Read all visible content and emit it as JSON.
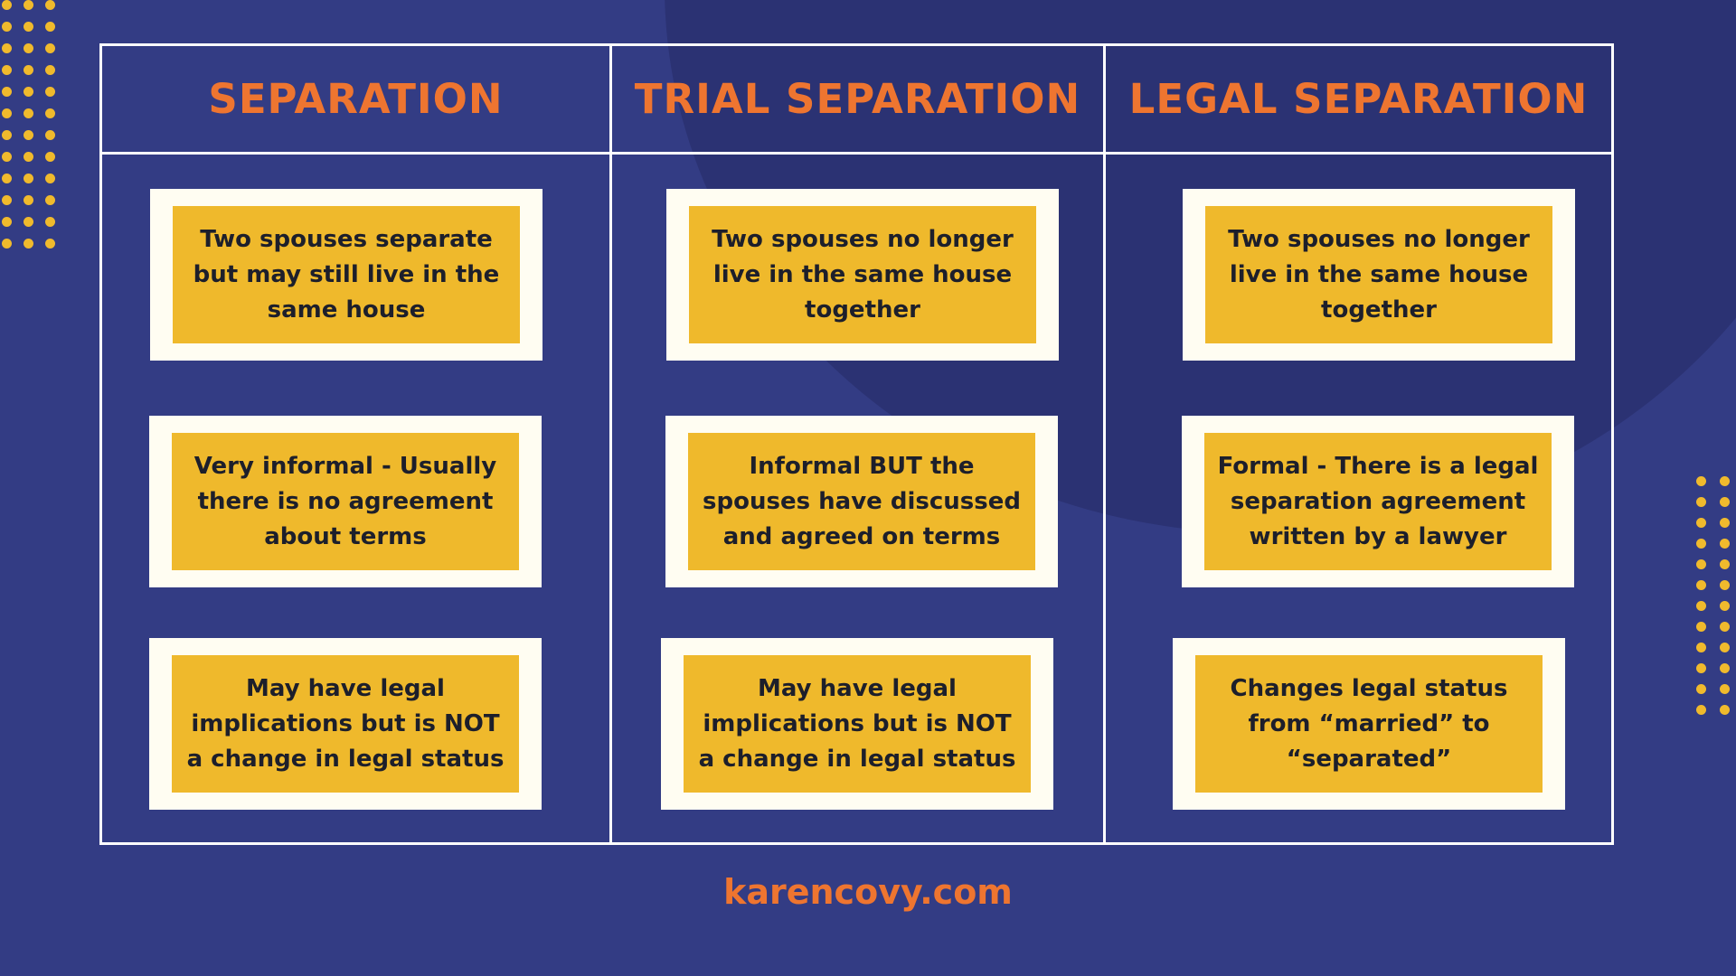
{
  "colors": {
    "background": "#333c84",
    "accent_orange": "#ee7530",
    "card_yellow": "#efb92c",
    "card_border": "#fffdf2",
    "dots": "#f0ba2d"
  },
  "columns": [
    {
      "title": "SEPARATION",
      "items": [
        "Two spouses separate but may still live in the same house",
        "Very informal - Usually there is no agreement about terms",
        "May have legal implications but is NOT a change in legal status"
      ]
    },
    {
      "title": "TRIAL SEPARATION",
      "items": [
        "Two spouses no longer live in the same house together",
        "Informal BUT the spouses have discussed and agreed on terms",
        "May have legal implications but is NOT a change in legal status"
      ]
    },
    {
      "title": "LEGAL SEPARATION",
      "items": [
        "Two spouses no longer live in the same house together",
        "Formal - There is a legal separation agreement written by a lawyer",
        "Changes legal status from “married” to “separated”"
      ]
    }
  ],
  "footer": {
    "website": "karencovy.com"
  }
}
